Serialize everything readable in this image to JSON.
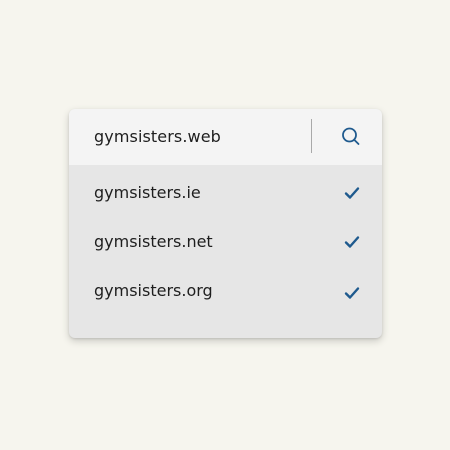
{
  "search": {
    "value": "gymsisters.web",
    "icon": "search-icon"
  },
  "results": [
    {
      "label": "gymsisters.ie",
      "icon": "checkmark-icon"
    },
    {
      "label": "gymsisters.net",
      "icon": "checkmark-icon"
    },
    {
      "label": "gymsisters.org",
      "icon": "checkmark-icon"
    }
  ],
  "colors": {
    "background": "#f6f5ee",
    "accent": "#1f5a8e",
    "text": "#1e1e1e"
  }
}
